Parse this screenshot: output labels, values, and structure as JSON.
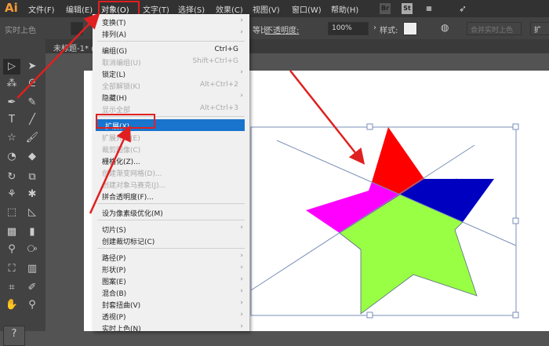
{
  "app": {
    "logo": "Ai",
    "document_tab": "未标题-1* @"
  },
  "menubar": {
    "items": [
      "文件(F)",
      "编辑(E)",
      "对象(O)",
      "文字(T)",
      "选择(S)",
      "效果(C)",
      "视图(V)",
      "窗口(W)",
      "帮助(H)"
    ],
    "icons": [
      "Br",
      "St"
    ]
  },
  "control_bar": {
    "label": "实时上色",
    "proportion": "等比",
    "opacity_label": "不透明度:",
    "opacity_value": "100%",
    "style_label": "样式:",
    "merge_button": "合并实时上色",
    "expand_button": "扩"
  },
  "object_menu": {
    "groups": [
      [
        {
          "label": "变换(T)",
          "sub": true
        },
        {
          "label": "排列(A)",
          "sub": true
        }
      ],
      [
        {
          "label": "编组(G)",
          "shortcut": "Ctrl+G"
        },
        {
          "label": "取消编组(U)",
          "shortcut": "Shift+Ctrl+G",
          "disabled": true
        },
        {
          "label": "锁定(L)",
          "sub": true
        },
        {
          "label": "全部解锁(K)",
          "shortcut": "Alt+Ctrl+2",
          "disabled": true
        },
        {
          "label": "隐藏(H)",
          "sub": true
        },
        {
          "label": "显示全部",
          "shortcut": "Alt+Ctrl+3",
          "disabled": true
        }
      ],
      [
        {
          "label": "扩展(X)...",
          "highlighted": true
        },
        {
          "label": "扩展外观(E)",
          "disabled": true
        },
        {
          "label": "裁剪图像(C)",
          "disabled": true
        },
        {
          "label": "栅格化(Z)..."
        },
        {
          "label": "创建渐变网格(D)...",
          "disabled": true
        },
        {
          "label": "创建对象马赛克(J)...",
          "disabled": true
        },
        {
          "label": "拼合透明度(F)..."
        }
      ],
      [
        {
          "label": "设为像素级优化(M)"
        }
      ],
      [
        {
          "label": "切片(S)",
          "sub": true
        },
        {
          "label": "创建裁切标记(C)"
        }
      ],
      [
        {
          "label": "路径(P)",
          "sub": true
        },
        {
          "label": "形状(P)",
          "sub": true
        },
        {
          "label": "图案(E)",
          "sub": true
        },
        {
          "label": "混合(B)",
          "sub": true
        },
        {
          "label": "封套扭曲(V)",
          "sub": true
        },
        {
          "label": "透视(P)",
          "sub": true
        },
        {
          "label": "实时上色(N)",
          "sub": true
        }
      ]
    ]
  },
  "colors": {
    "star_top": "#ff0000",
    "star_right": "#0000c0",
    "star_left": "#ff00ff",
    "star_body": "#99ff44",
    "selection": "#7a8fb8",
    "annotation": "#e02020",
    "menu_highlight": "#1874cd"
  }
}
